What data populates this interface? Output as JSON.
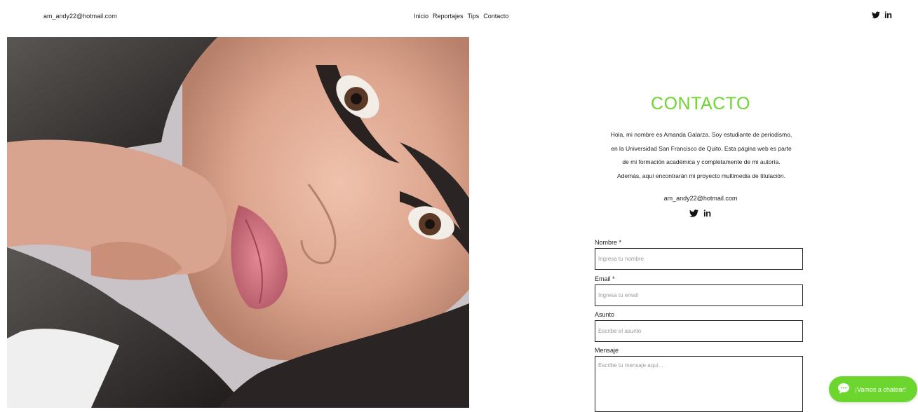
{
  "header": {
    "email": "am_andy22@hotmail.com",
    "nav": [
      "Inicio",
      "Reportajes",
      "Tips",
      "Contacto"
    ],
    "social": [
      "twitter-icon",
      "linkedin-icon"
    ],
    "linkedin_glyph": "in"
  },
  "contact": {
    "title": "CONTACTO",
    "bio_lines": [
      "Hola, mi nombre es Amanda Galarza. Soy estudiante de periodismo,",
      "en la Universidad San Francisco de Quito. Esta página web es parte",
      "de mi formación académica y completamente de mi autoría.",
      "Además, aquí encontrarán mi proyecto multimedia de titulación."
    ],
    "email": "am_andy22@hotmail.com",
    "linkedin_glyph": "in"
  },
  "form": {
    "name_label": "Nombre *",
    "name_placeholder": "Ingresa tu nombre",
    "email_label": "Email *",
    "email_placeholder": "Ingresa tu email",
    "subject_label": "Asunto",
    "subject_placeholder": "Escribe el asunto",
    "message_label": "Mensaje",
    "message_placeholder": "Escribe tu mensaje aquí..."
  },
  "chat": {
    "label": "¡Vamos a chatear!",
    "icon": "chat-bubble-icon"
  },
  "colors": {
    "accent": "#6cd62e",
    "text": "#1a1a1a",
    "background": "#ffffff"
  }
}
